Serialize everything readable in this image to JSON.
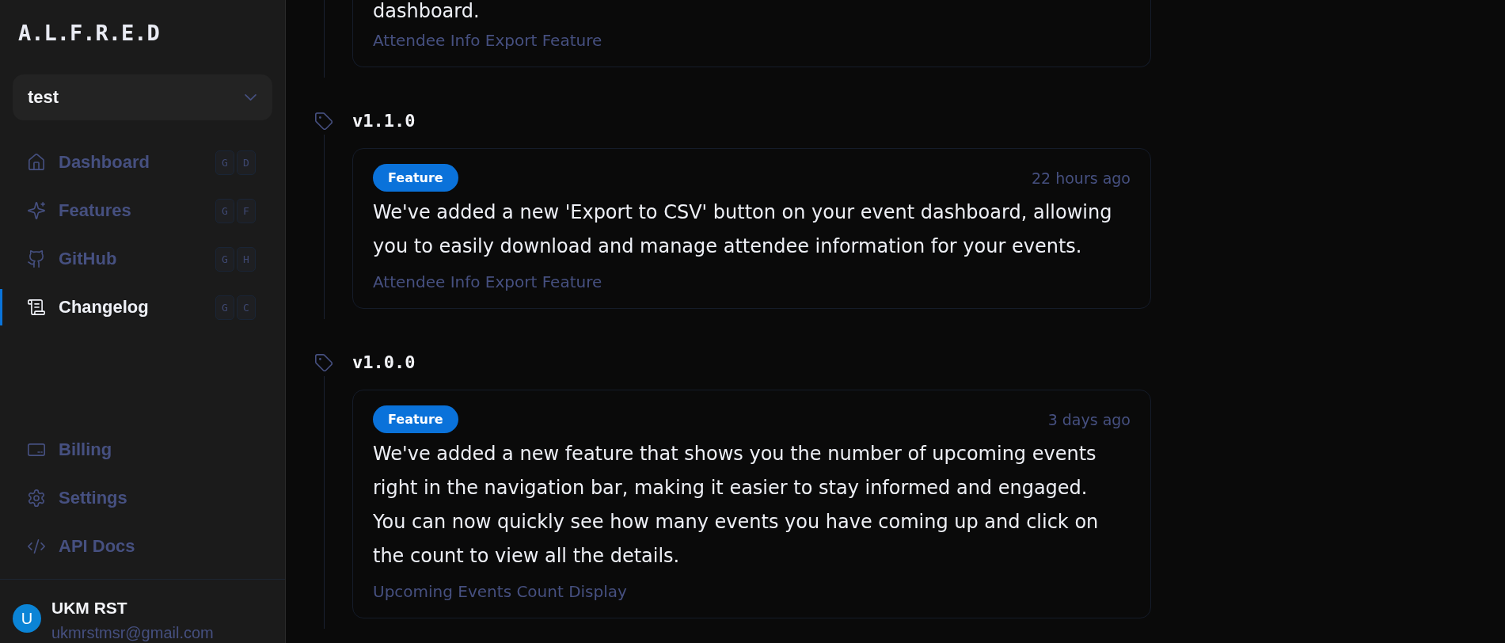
{
  "sidebar": {
    "logo": "A.L.F.R.E.D",
    "workspace": {
      "value": "test"
    },
    "nav": [
      {
        "label": "Dashboard",
        "keys": [
          "G",
          "D"
        ],
        "selected": false
      },
      {
        "label": "Features",
        "keys": [
          "G",
          "F"
        ],
        "selected": false
      },
      {
        "label": "GitHub",
        "keys": [
          "G",
          "H"
        ],
        "selected": false
      },
      {
        "label": "Changelog",
        "keys": [
          "G",
          "C"
        ],
        "selected": true
      }
    ],
    "bottom_nav": [
      {
        "label": "Billing",
        "selected": false
      },
      {
        "label": "Settings",
        "selected": false
      },
      {
        "label": "API Docs",
        "selected": false
      }
    ],
    "user": {
      "initial": "U",
      "name": "UKM RST",
      "email": "ukmrstmsr@gmail.com"
    }
  },
  "changelog": {
    "releases": [
      {
        "entries": [
          {
            "description": "dashboard.",
            "feature": "Attendee Info Export Feature"
          }
        ]
      },
      {
        "version": "v1.1.0",
        "entries": [
          {
            "category": "Feature",
            "time": "22 hours ago",
            "description": "We've added a new 'Export to CSV' button on your event dashboard, allowing you to easily download and manage attendee information for your events.",
            "feature": "Attendee Info Export Feature"
          }
        ]
      },
      {
        "version": "v1.0.0",
        "entries": [
          {
            "category": "Feature",
            "time": "3 days ago",
            "description": "We've added a new feature that shows you the number of upcoming events right in the navigation bar, making it easier to stay informed and engaged. You can now quickly see how many events you have coming up and click on the count to view all the details.",
            "feature": "Upcoming Events Count Display"
          }
        ]
      }
    ]
  }
}
